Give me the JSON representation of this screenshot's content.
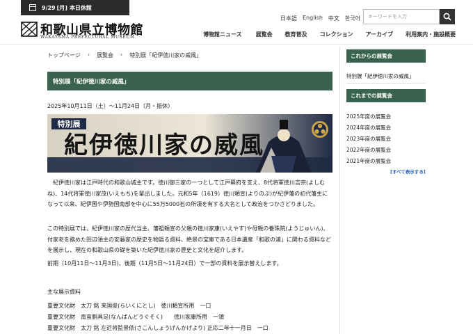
{
  "header": {
    "closed_date": "9/29",
    "closed_weekday": "[月]",
    "closed_label": "本日休館",
    "logo_ja": "和歌山県立博物館",
    "logo_en": "WAKAYAMA PREFECTURAL MUSEUM",
    "languages": [
      "日本語",
      "English",
      "中文",
      "한국어"
    ],
    "search_placeholder": "キーワードを入力",
    "nav": [
      "博物館ニュース",
      "展覧会",
      "教育普及",
      "コレクション",
      "アーカイブ",
      "利用案内・施設概要"
    ]
  },
  "breadcrumb": [
    "トップページ",
    "展覧会",
    "特別展「紀伊徳川家の威風」"
  ],
  "main": {
    "title": "特別展「紀伊徳川家の威風」",
    "period": "2025年10月11日（土）～11月24日（月・振休）",
    "banner": {
      "tag": "特別展",
      "headline": "紀伊徳川家の威風"
    },
    "paragraphs": [
      "紀伊徳川家は江戸時代の和歌山城主です。徳川御三家の一つとして江戸幕府を支え、8代将軍徳川吉宗(よしむね)、14代将軍徳川家茂(いえもち)を輩出しました。元和5年（1619）徳川頼宣(よりのぶ)が紀伊藩の初代藩主になって以来、紀伊国や伊勢国南部を中心に55万5000石の所領を有する大名として政治をつかさどりました。",
      "この特別展では、紀伊徳川家の歴代当主、藩祖頼宣の父親の徳川家康(いえやす)や母親の養珠院(ようじゅいん)、付家老を務めた田辺領主の安藤家の歴史を物語る資料、絶景の宝庫である日本遺産「和歌の浦」に関わる資料などを展示し、現在の和歌山県の礎を築いた紀伊徳川家の歴史と文化を紹介します。",
      "前期（10月11日～11月3日)、後期（11月5日～11月24日）で一部の資料を展示替えします。"
    ],
    "exhibits_heading": "主な展示資料",
    "exhibits": [
      "重要文化財　太刀 銘 来国俊(らいくにとし)　徳川頼宣所用　一口",
      "重要文化財　南蛮胴具足(なんばんどうぐそく)　　徳川家康所用　一領",
      "重要文化財　太刀 銘 左近将監景依(さこんしょうげんかげより) 正応二年十一月日　一口"
    ]
  },
  "sidebar": {
    "upcoming_heading": "これからの展覧会",
    "upcoming_items": [
      "特別展「紀伊徳川家の威風」"
    ],
    "past_heading": "これまでの展覧会",
    "past_items": [
      "2025年度の展覧会",
      "2024年度の展覧会",
      "2023年度の展覧会",
      "2022年度の展覧会",
      "2021年度の展覧会"
    ],
    "show_all": "[すべて表示する]"
  },
  "colors": {
    "accent_green": "#39634f",
    "header_dark": "#2b2b2b",
    "banner_navy": "#1f2a44",
    "link_blue": "#1a5fb4"
  }
}
